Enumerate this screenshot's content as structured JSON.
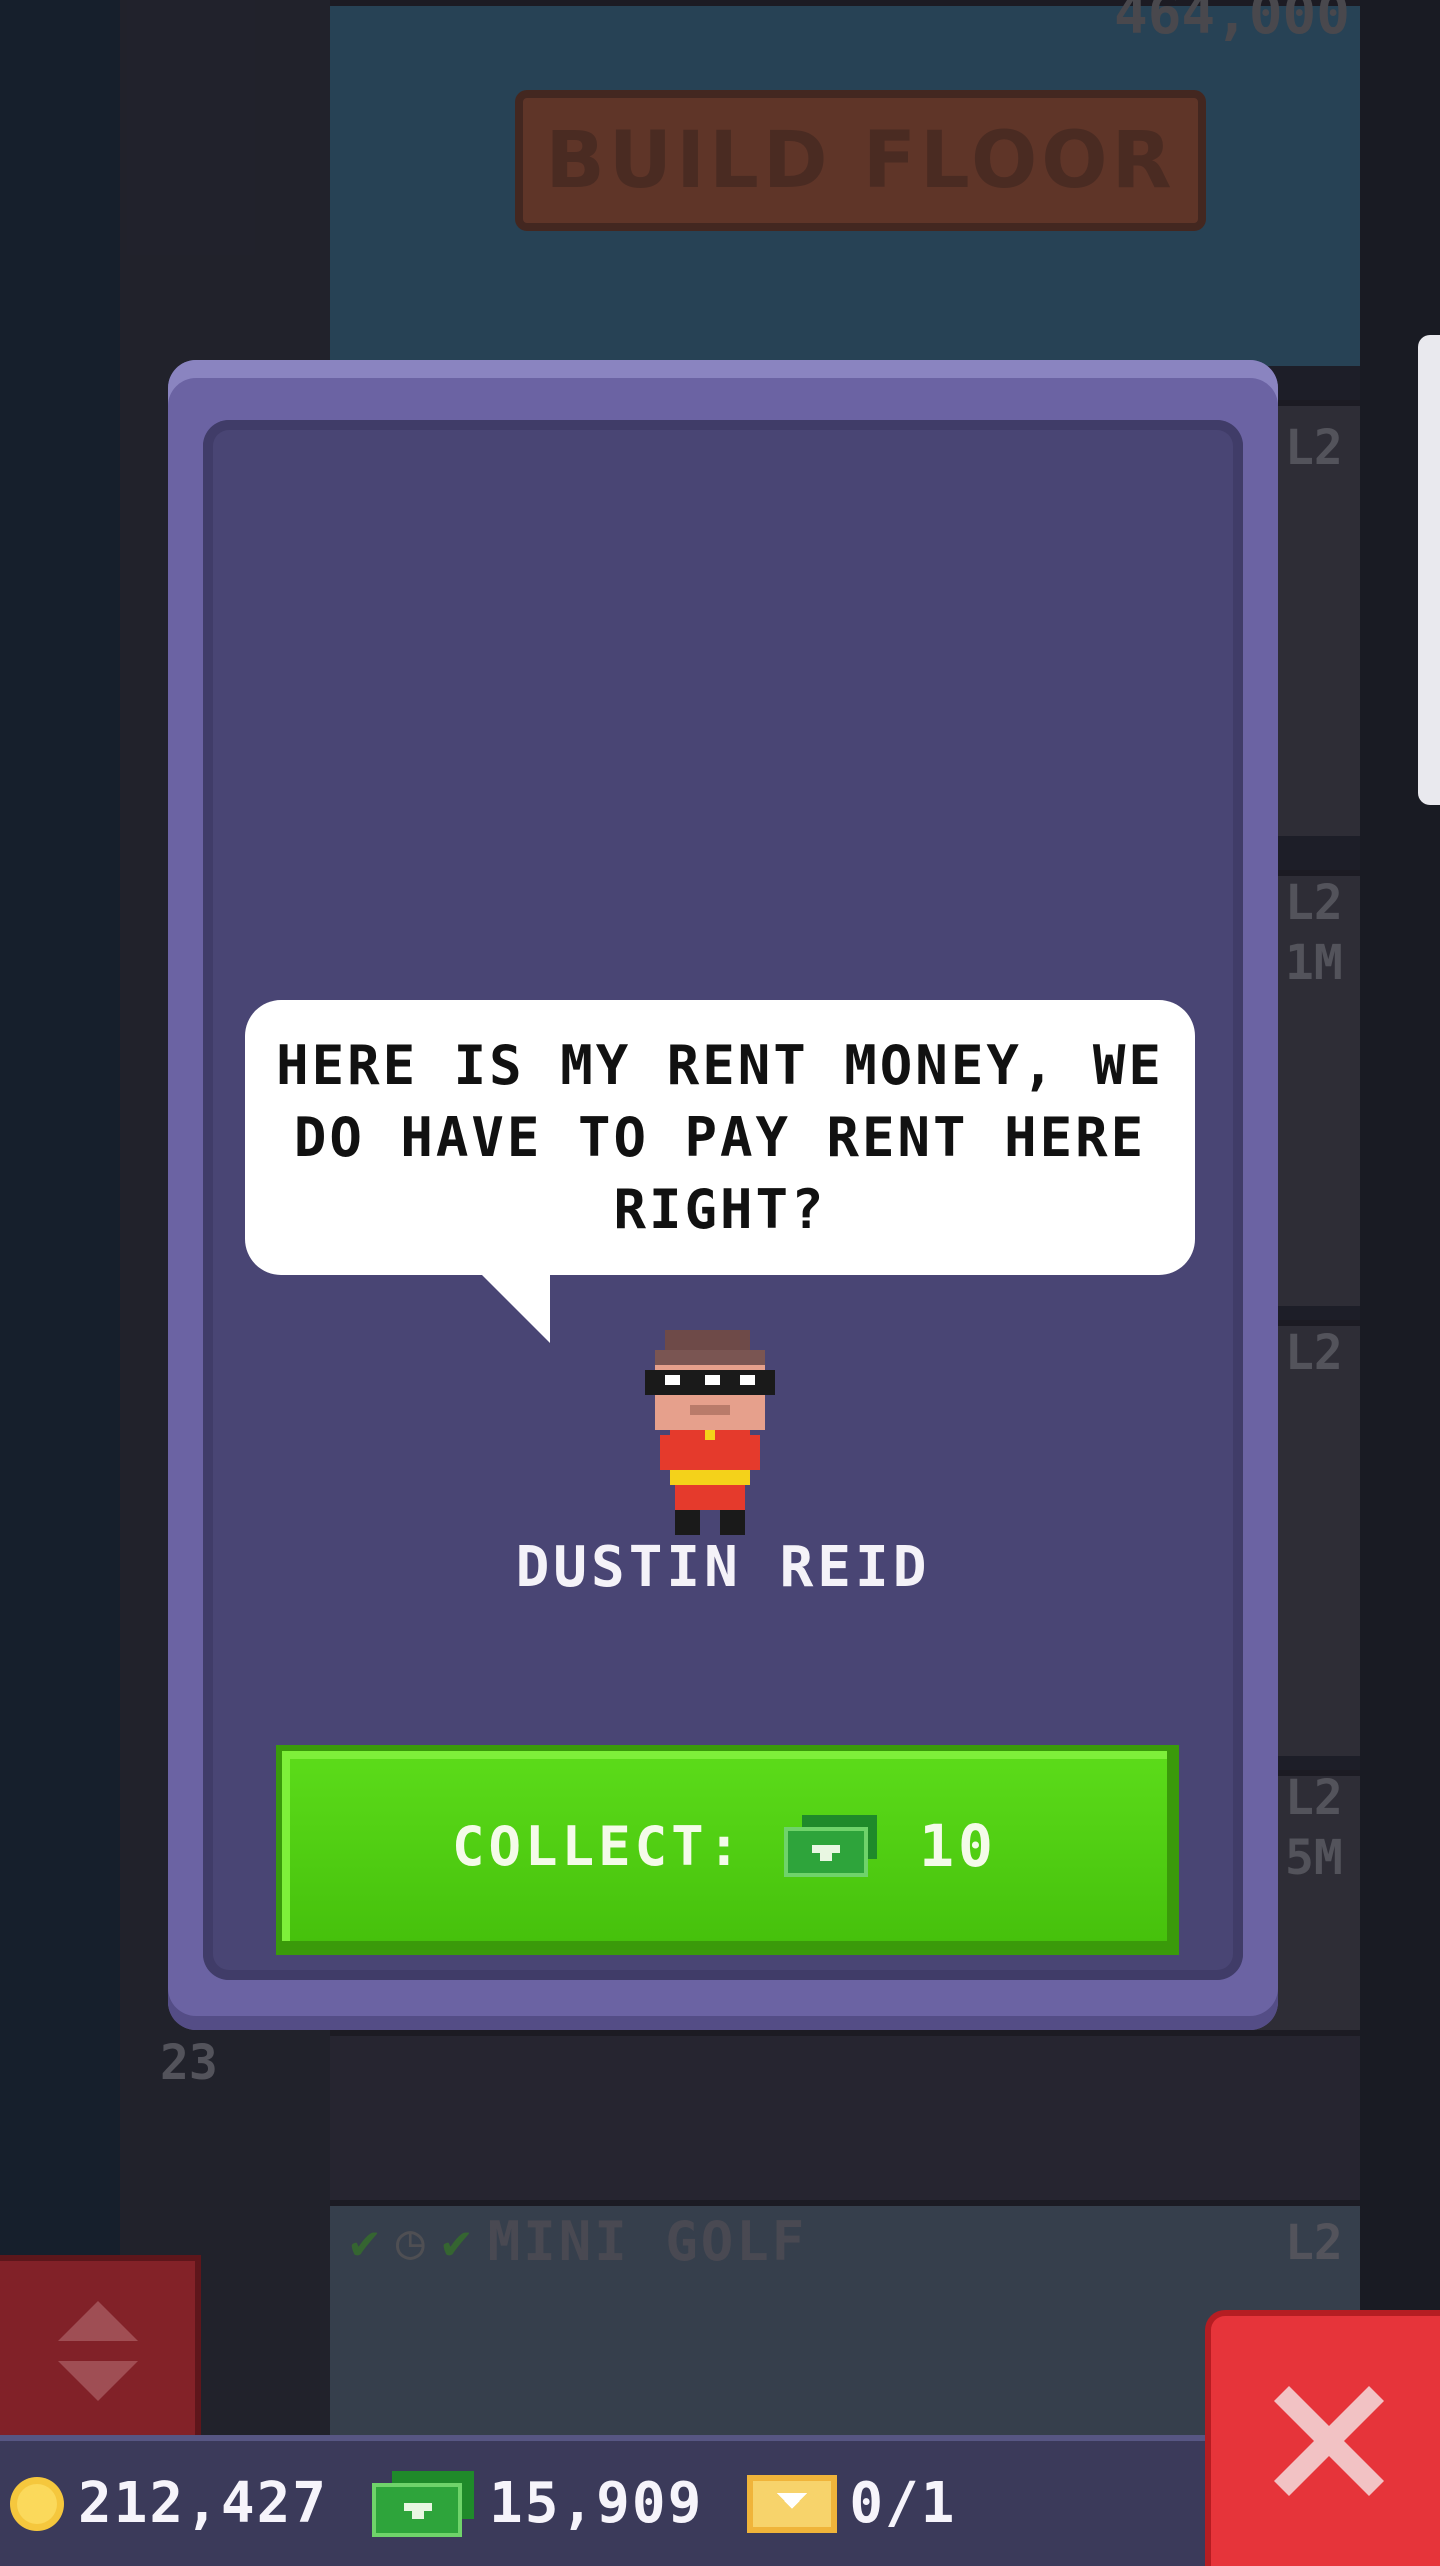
{
  "background": {
    "build_floor_sign": "BUILD FLOOR",
    "top_counter": "464,000",
    "floor_labels": [
      "L2",
      "L2",
      "1M",
      "L2",
      "L2",
      "5M",
      "L2"
    ],
    "floor_number": "23",
    "mini_golf_label": "MINI GOLF"
  },
  "dialog": {
    "speech": "HERE IS MY RENT MONEY, WE DO HAVE TO PAY RENT HERE RIGHT?",
    "character_name": "DUSTIN REID",
    "collect_label": "COLLECT:",
    "collect_amount": "10"
  },
  "status_bar": {
    "coins": "212,427",
    "bux": "15,909",
    "tickets": "0/1"
  },
  "colors": {
    "modal": "#6b63a3",
    "collect_button": "#4fcc12",
    "close_button": "#e6343a",
    "coin": "#f5c73d",
    "bux": "#2ea43b"
  },
  "icons": {
    "coin": "coin-icon",
    "bux": "bux-icon",
    "ticket": "golden-ticket-icon",
    "close": "close-icon",
    "elevator": "elevator-arrows-icon"
  }
}
